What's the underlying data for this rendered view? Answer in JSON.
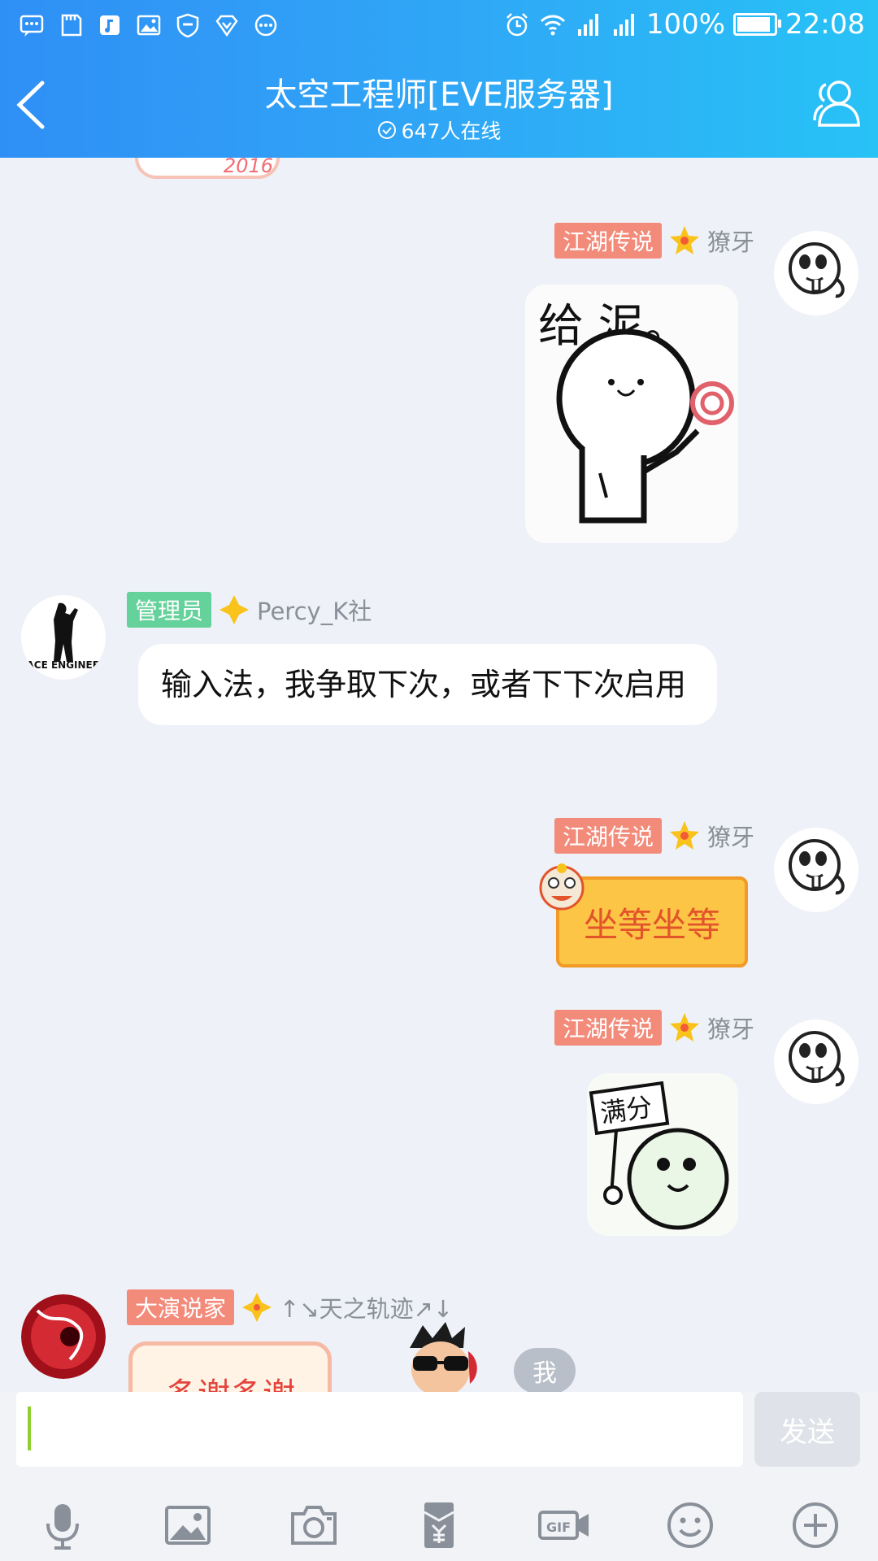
{
  "status_bar": {
    "battery": "100%",
    "time": "22:08"
  },
  "header": {
    "title": "太空工程师[EVE服务器]",
    "online": "647人在线"
  },
  "messages": [
    {
      "tag": "江湖传说",
      "name": "獠牙",
      "sticker_text": "给 泥。"
    },
    {
      "tag": "管理员",
      "name": "Percy_K社",
      "text": "输入法，我争取下次，或者下下次启用",
      "avatar_text": "SPACE ENGINEERS"
    },
    {
      "tag": "江湖传说",
      "name": "獠牙",
      "sticker_text": "坐等坐等"
    },
    {
      "tag": "江湖传说",
      "name": "獠牙",
      "sticker_text": "满分"
    },
    {
      "tag": "大演说家",
      "name": "↑↘天之轨迹↗↓",
      "sticker_text": "多谢多谢",
      "side_label": "我"
    }
  ],
  "top_partial_sticker": "2016",
  "input": {
    "value": "",
    "send_label": "发送"
  },
  "toolbar": [
    {
      "icon": "microphone-icon"
    },
    {
      "icon": "image-icon"
    },
    {
      "icon": "camera-icon"
    },
    {
      "icon": "red-packet-icon"
    },
    {
      "icon": "gif-icon",
      "label": "GIF"
    },
    {
      "icon": "emoji-icon"
    },
    {
      "icon": "plus-icon"
    }
  ]
}
